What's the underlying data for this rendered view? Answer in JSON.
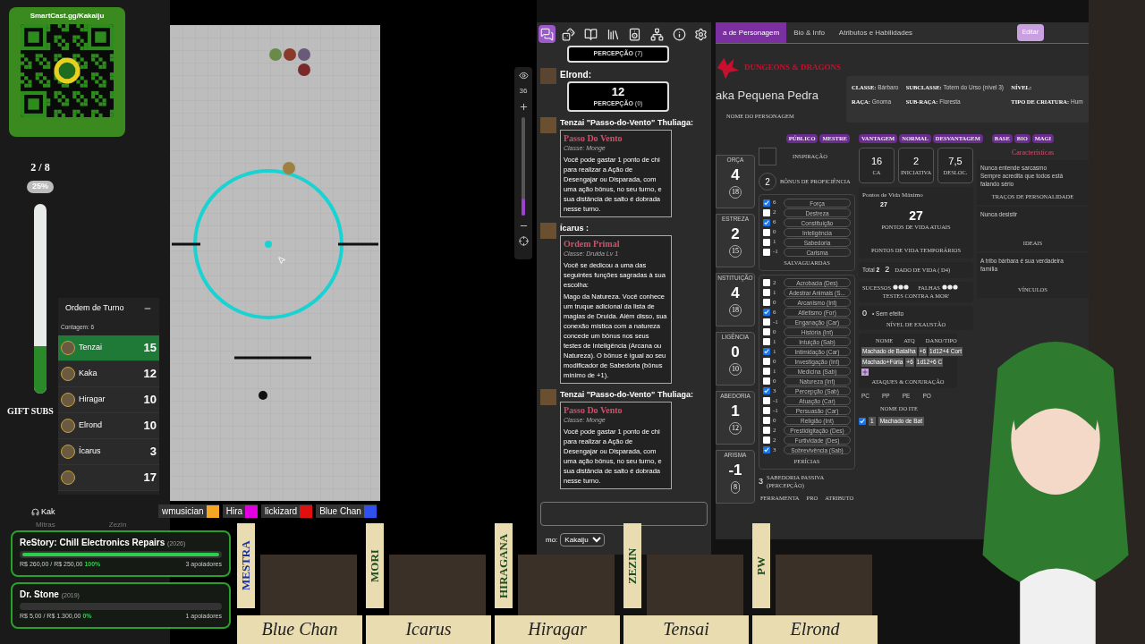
{
  "qr_card": {
    "url": "SmartCast.gg/Kakaiju"
  },
  "sub_goal": {
    "count": "2 / 8",
    "percent": "25%",
    "level": 0.25,
    "label": "GIFT SUBS"
  },
  "map_toolbar": {
    "zoom": "36",
    "level": 0.17
  },
  "turn_order": {
    "title": "Ordem de Turno",
    "count": "Contagem: 6",
    "entries": [
      {
        "name": "Tenzai",
        "initiative": "15",
        "selected": true
      },
      {
        "name": "Kaka",
        "initiative": "12",
        "selected": false
      },
      {
        "name": "Hiragar",
        "initiative": "10",
        "selected": false
      },
      {
        "name": "Elrond",
        "initiative": "10",
        "selected": false
      },
      {
        "name": "Ícarus",
        "initiative": "3",
        "selected": false
      },
      {
        "initiative": "17",
        "selected": false
      }
    ]
  },
  "voice_users": [
    "Kak",
    "Mitras",
    "Zezin"
  ],
  "players_bar": [
    {
      "name": "wmusician",
      "color": "#f5a623"
    },
    {
      "name": "Hira",
      "color": "#e000e0"
    },
    {
      "name": "lickizard",
      "color": "#e01010"
    },
    {
      "name": "Blue Chan",
      "color": "#3050f0"
    }
  ],
  "donation_goals": [
    {
      "title": "ReStory: Chill Electronics Repairs",
      "year": "(2026)",
      "amounts": "R$ 260,00 / R$ 250,00",
      "percent": "100%",
      "supporters": "3 apoiadores",
      "level": 1
    },
    {
      "title": "Dr. Stone",
      "year": "(2019)",
      "amounts": "R$ 5,00 / R$ 1.300,00",
      "percent": "0%",
      "supporters": "1 apoiadores",
      "level": 0
    }
  ],
  "chat": {
    "tabs": [
      {
        "kind": "chat",
        "selected": true
      },
      {
        "kind": "dice",
        "selected": false
      },
      {
        "kind": "journal",
        "selected": false
      },
      {
        "kind": "library",
        "selected": false
      },
      {
        "kind": "jukebox",
        "selected": false
      },
      {
        "kind": "nodes",
        "selected": false
      },
      {
        "kind": "info",
        "selected": false
      },
      {
        "kind": "settings",
        "selected": false
      }
    ],
    "messages": [
      {
        "kind": "roll",
        "label": "PERCEPÇÃO",
        "modifier": "(7)"
      },
      {
        "kind": "roll",
        "author": "Elrond:",
        "value": "12",
        "label": "PERCEPÇÃO",
        "modifier": "(0)"
      },
      {
        "kind": "ability",
        "author": "Tenzai \"Passo-do-Vento\" Thuliaga:",
        "title": "Passo Do Vento",
        "subtitle": "Classe: Monge",
        "paragraphs": [
          "Você pode gastar 1 ponto de chi para realizar a Ação de Desengajar ou Disparada, com uma ação bônus, no seu turno, e sua distância de salto é dobrada nesse turno."
        ]
      },
      {
        "kind": "ability",
        "author": "Ícarus :",
        "title": "Ordem Primal",
        "subtitle": "Classe: Druida Lv 1",
        "paragraphs": [
          "Você se dedicou a uma das seguintes funções sagradas à sua escolha:",
          "Mago da Natureza. Você conhece um truque adicional da lista de magias de Druida. Além disso, sua conexão mística com a natureza concede um bônus nos seus testes de Inteligência (Arcana ou Natureza). O bônus é igual ao seu modificador de Sabedoria (bônus mínimo de +1)."
        ]
      },
      {
        "kind": "ability",
        "author": "Tenzai \"Passo-do-Vento\" Thuliaga:",
        "title": "Passo Do Vento",
        "subtitle": "Classe: Monge",
        "paragraphs": [
          "Você pode gastar 1 ponto de chi para realizar a Ação de Desengajar ou Disparada, com uma ação bônus, no seu turno, e sua distância de salto é dobrada nesse turno."
        ]
      }
    ],
    "speaking_as_label": "mo:",
    "speaking_as": "Kakaiju"
  },
  "character_sheet": {
    "tabs": [
      {
        "label": "a de Personagem",
        "selected": true
      },
      {
        "label": "Bio & Info",
        "selected": false
      },
      {
        "label": "Atributos e Habilidades",
        "selected": false
      }
    ],
    "edit_button": "Editar",
    "logo": "DUNGEONS & DRAGONS",
    "name": "aka Pequena Pedra",
    "name_label": "NOME DO PERSONAGEM",
    "info": [
      {
        "label": "CLASSE:",
        "value": "Bárbaro"
      },
      {
        "label": "SUBCLASSE:",
        "value": "Totem do Urso (nível 3)"
      },
      {
        "label": "NÍVEL:"
      },
      {
        "label": "RAÇA:",
        "value": "Gnoma"
      },
      {
        "label": "SUB-RAÇA:",
        "value": "Floresta"
      },
      {
        "label": "TIPO DE CRIATURA:",
        "value": "Hum"
      }
    ],
    "toggle_groups": [
      [
        "PÚBLICO",
        "MESTRE"
      ],
      [
        "VANTAGEM",
        "NORMAL",
        "DESVANTAGEM"
      ],
      [
        "BASE",
        "BIO",
        "MAGI"
      ]
    ],
    "attributes": [
      {
        "label": "ORÇA",
        "value": "4",
        "score": "18"
      },
      {
        "label": "ESTREZA",
        "value": "2",
        "score": "15"
      },
      {
        "label": "NSTITUIÇÃO",
        "value": "4",
        "score": "18"
      },
      {
        "label": "LIGÊNCIA",
        "value": "0",
        "score": "10"
      },
      {
        "label": "ABEDORIA",
        "value": "1",
        "score": "12"
      },
      {
        "label": "ARISMA",
        "value": "-1",
        "score": "8"
      }
    ],
    "inspiration": "INSPIRAÇÃO",
    "proficiency": {
      "value": "2",
      "label": "BÔNUS DE PROFICIÊNCIA"
    },
    "saves": {
      "title": "SALVAGUARDAS",
      "items": [
        {
          "value": "6",
          "name": "Força",
          "checked": true
        },
        {
          "value": "2",
          "name": "Destreza",
          "checked": false
        },
        {
          "value": "6",
          "name": "Constituição",
          "checked": true
        },
        {
          "value": "0",
          "name": "Inteligência",
          "checked": false
        },
        {
          "value": "1",
          "name": "Sabedoria",
          "checked": false
        },
        {
          "value": "-1",
          "name": "Carisma",
          "checked": false
        }
      ]
    },
    "skills": {
      "title": "PERÍCIAS",
      "items": [
        {
          "value": "2",
          "name": "Acrobacia (Des)",
          "checked": false
        },
        {
          "value": "1",
          "name": "Adestrar Animais (S...",
          "checked": false
        },
        {
          "value": "0",
          "name": "Arcanismo (Int)",
          "checked": false
        },
        {
          "value": "6",
          "name": "Atletismo (For)",
          "checked": true
        },
        {
          "value": "-1",
          "name": "Enganação (Car)",
          "checked": false
        },
        {
          "value": "0",
          "name": "História (Int)",
          "checked": false
        },
        {
          "value": "1",
          "name": "Intuição (Sab)",
          "checked": false
        },
        {
          "value": "1",
          "name": "Intimidação (Car)",
          "checked": true
        },
        {
          "value": "0",
          "name": "Investigação (Int)",
          "checked": false
        },
        {
          "value": "1",
          "name": "Medicina (Sab)",
          "checked": false
        },
        {
          "value": "0",
          "name": "Natureza (Int)",
          "checked": false
        },
        {
          "value": "3",
          "name": "Percepção (Sab)",
          "checked": true
        },
        {
          "value": "-1",
          "name": "Atuação (Car)",
          "checked": false
        },
        {
          "value": "-1",
          "name": "Persuasão (Car)",
          "checked": false
        },
        {
          "value": "0",
          "name": "Religião (Int)",
          "checked": false
        },
        {
          "value": "2",
          "name": "Prestidigitação (Des)",
          "checked": false
        },
        {
          "value": "2",
          "name": "Furtividade (Des)",
          "checked": false
        },
        {
          "value": "3",
          "name": "Sobrevivência (Sab)",
          "checked": true
        }
      ]
    },
    "passive": {
      "value": "3",
      "label": "SABEDORIA PASSIVA (PERCEPÇÃO)"
    },
    "tools_columns": [
      "FERRAMENTA",
      "PRO",
      "ATRIBUTO"
    ],
    "combat": [
      {
        "value": "16",
        "label": "CA"
      },
      {
        "value": "2",
        "label": "INICIATIVA"
      },
      {
        "value": "7,5",
        "label": "DESLOC."
      }
    ],
    "hp": {
      "max_label": "Pontos de Vida Máximo",
      "max": "27",
      "current": "27",
      "current_label": "PONTOS DE VIDA ATUAIS",
      "temp_label": "PONTOS DE VIDA TEMPORÁRIOS"
    },
    "hit_dice": {
      "total_label": "Total",
      "total": "2",
      "value": "2",
      "label": "DADO DE VIDA",
      "die": "( D4)"
    },
    "death_saves": {
      "successes": "SUCESSOS",
      "failures": "FALHAS",
      "label": "TESTES CONTRA A MOR'"
    },
    "exhaustion": {
      "value": "0",
      "note": "• Sem efeito",
      "label": "NÍVEL DE EXAUSTÃO"
    },
    "attacks": {
      "columns": [
        "NOME",
        "ATQ",
        "DANO/TIPO"
      ],
      "rows": [
        {
          "name": "Machado de Batalha",
          "bonus": "+6",
          "damage": "1d12+4 Cort"
        },
        {
          "name": "Machado+Fúria",
          "bonus": "+6",
          "damage": "1d12+6 C"
        }
      ],
      "title": "ATAQUES & CONJURAÇÃO"
    },
    "coins": [
      "PC",
      "PP",
      "PE",
      "PO"
    ],
    "items": {
      "column": "NOME DO ITE",
      "rows": [
        {
          "qty": "1",
          "name": "Machado de Bat",
          "checked": true
        }
      ]
    },
    "traits_title": "Características",
    "traits": [
      {
        "text": "Nunca entende sarcasmo\nSempre acredita que todos está\nfalando sério",
        "label": "TRAÇOS DE PERSONALIDADE"
      },
      {
        "text": "Nunca desistir",
        "label": "IDEAIS"
      },
      {
        "text": "A tribo bárbara é sua verdadeira\nfamília",
        "label": "VÍNCULOS"
      }
    ]
  },
  "party": [
    {
      "player": "MESTRA",
      "character": "Blue Chan",
      "color": "#1c2fa0"
    },
    {
      "player": "MORI",
      "character": "Icarus",
      "color": "#1f4d1f"
    },
    {
      "player": "HIRAGANA",
      "character": "Hiragar",
      "color": "#1f4d1f"
    },
    {
      "player": "ZEZIN",
      "character": "Tensai",
      "color": "#1f4d1f"
    },
    {
      "player": "PW",
      "character": "Elrond",
      "color": "#1f4d1f"
    }
  ]
}
